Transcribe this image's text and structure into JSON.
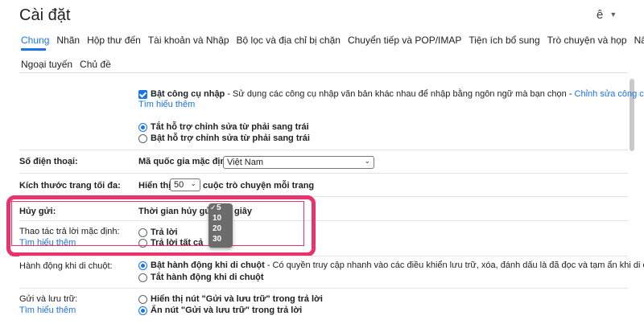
{
  "header": {
    "title": "Cài đặt",
    "account_initial": "ê"
  },
  "tabs": {
    "row1": [
      "Chung",
      "Nhãn",
      "Hộp thư đến",
      "Tài khoản và Nhập",
      "Bộ lọc và địa chỉ bị chặn",
      "Chuyển tiếp và POP/IMAP",
      "Tiện ích bổ sung",
      "Trò chuyện và họp",
      "Nâng cao"
    ],
    "row2": [
      "Ngoại tuyến",
      "Chủ đề"
    ],
    "active": "Chung"
  },
  "input_tools": {
    "label": "Bật công cụ nhập",
    "desc": " - Sử dụng các công cụ nhập văn bản khác nhau để nhập bằng ngôn ngữ mà bạn chọn - ",
    "edit_link": "Chỉnh sửa công cụ",
    "dash": " -",
    "learn_more": "Tìm hiểu thêm",
    "checked": true
  },
  "rtl": {
    "off_label": "Tắt hỗ trợ chỉnh sửa từ phải sang trái",
    "on_label": "Bật hỗ trợ chỉnh sửa từ phải sang trái",
    "selected": "off"
  },
  "phone": {
    "label": "Số điện thoại:",
    "field_label": "Mã quốc gia mặc định:",
    "value": "Việt Nam"
  },
  "page_size": {
    "label": "Kích thước trang tối đa:",
    "prefix": "Hiển thị",
    "value": "50",
    "suffix": "cuộc trò chuyện mỗi trang"
  },
  "undo_send": {
    "label": "Hủy gửi:",
    "field_label": "Thời gian hủy gửi",
    "unit": "giây",
    "options": [
      "5",
      "10",
      "20",
      "30"
    ],
    "selected": "5"
  },
  "reply_default": {
    "label": "Thao tác trả lời mặc định:",
    "learn_more": "Tìm hiểu thêm",
    "reply": "Trả lời",
    "reply_all": "Trả lời tất cả"
  },
  "hover": {
    "label": "Hành động khi di chuột:",
    "on_bold": "Bật hành động khi di chuột",
    "on_desc": " - Có quyền truy cập nhanh vào các điều khiển lưu trữ, xóa, đánh dấu là đã đọc và tạm ẩn khi di chuột.",
    "off_label": "Tắt hành động khi di chuột",
    "selected": "on"
  },
  "send_archive": {
    "label": "Gửi và lưu trữ:",
    "learn_more": "Tìm hiểu thêm",
    "show_label": "Hiển thị nút \"Gửi và lưu trữ\" trong trả lời",
    "hide_label": "Ẩn nút \"Gửi và lưu trữ\" trong trả lời",
    "selected": "hide"
  },
  "colors": {
    "accent": "#1a73e8",
    "highlight": "#e8336b"
  }
}
